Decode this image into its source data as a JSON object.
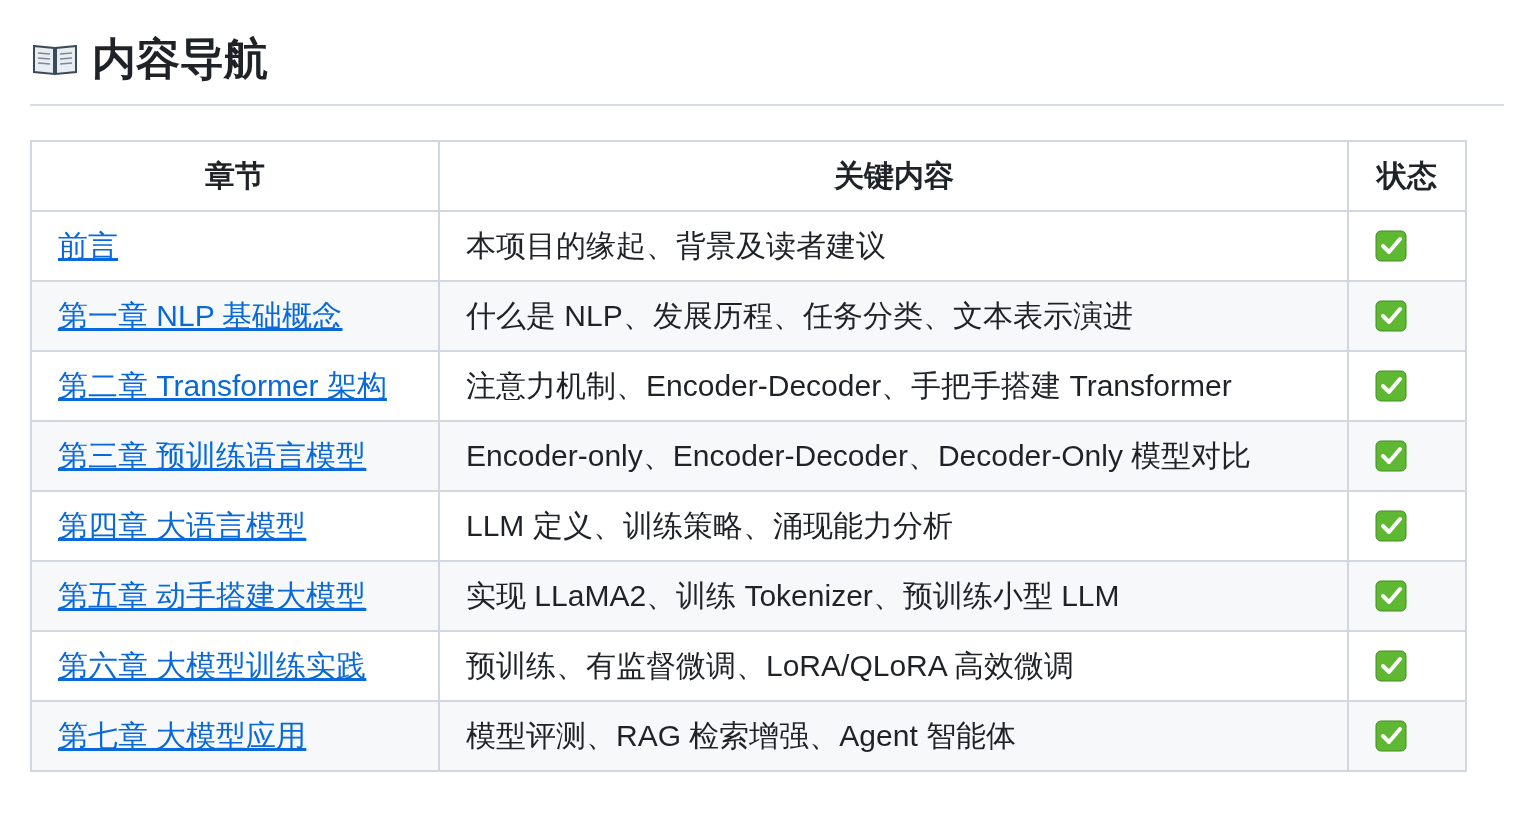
{
  "heading": "内容导航",
  "table": {
    "columns": [
      "章节",
      "关键内容",
      "状态"
    ],
    "rows": [
      {
        "chapter": "前言",
        "content": "本项目的缘起、背景及读者建议",
        "done": true
      },
      {
        "chapter": "第一章 NLP 基础概念",
        "content": "什么是 NLP、发展历程、任务分类、文本表示演进",
        "done": true
      },
      {
        "chapter": "第二章 Transformer 架构",
        "content": "注意力机制、Encoder-Decoder、手把手搭建 Transformer",
        "done": true
      },
      {
        "chapter": "第三章 预训练语言模型",
        "content": "Encoder-only、Encoder-Decoder、Decoder-Only 模型对比",
        "done": true
      },
      {
        "chapter": "第四章 大语言模型",
        "content": "LLM 定义、训练策略、涌现能力分析",
        "done": true
      },
      {
        "chapter": "第五章 动手搭建大模型",
        "content": "实现 LLaMA2、训练 Tokenizer、预训练小型 LLM",
        "done": true
      },
      {
        "chapter": "第六章 大模型训练实践",
        "content": "预训练、有监督微调、LoRA/QLoRA 高效微调",
        "done": true
      },
      {
        "chapter": "第七章 大模型应用",
        "content": "模型评测、RAG 检索增强、Agent 智能体",
        "done": true
      }
    ]
  }
}
